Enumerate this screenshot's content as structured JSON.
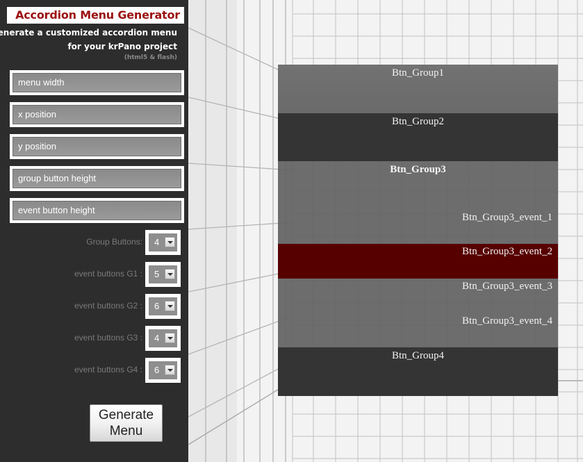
{
  "sidebar": {
    "title": "Accordion Menu Generator",
    "subtitle_line1": "generate a customized accordion menu",
    "subtitle_line2": "for your krPano project",
    "subtitle_note": "(html5 & flash)",
    "fields": [
      {
        "label": "menu width"
      },
      {
        "label": "x position"
      },
      {
        "label": "y position"
      },
      {
        "label": "group button height"
      },
      {
        "label": "event button height"
      }
    ],
    "selects": [
      {
        "label": "Group Buttons:",
        "value": "4"
      },
      {
        "label": "event buttons G1 :",
        "value": "5"
      },
      {
        "label": "event buttons G2 :",
        "value": "6"
      },
      {
        "label": "event buttons G3 :",
        "value": "4"
      },
      {
        "label": "event buttons G4 :",
        "value": "6"
      }
    ],
    "generate_line1": "Generate",
    "generate_line2": "Menu"
  },
  "accordion": {
    "group1": "Btn_Group1",
    "group2": "Btn_Group2",
    "group3": "Btn_Group3",
    "group3_events": [
      "Btn_Group3_event_1",
      "Btn_Group3_event_2",
      "Btn_Group3_event_3",
      "Btn_Group3_event_4"
    ],
    "group4": "Btn_Group4",
    "active_event_color": "#570000"
  }
}
